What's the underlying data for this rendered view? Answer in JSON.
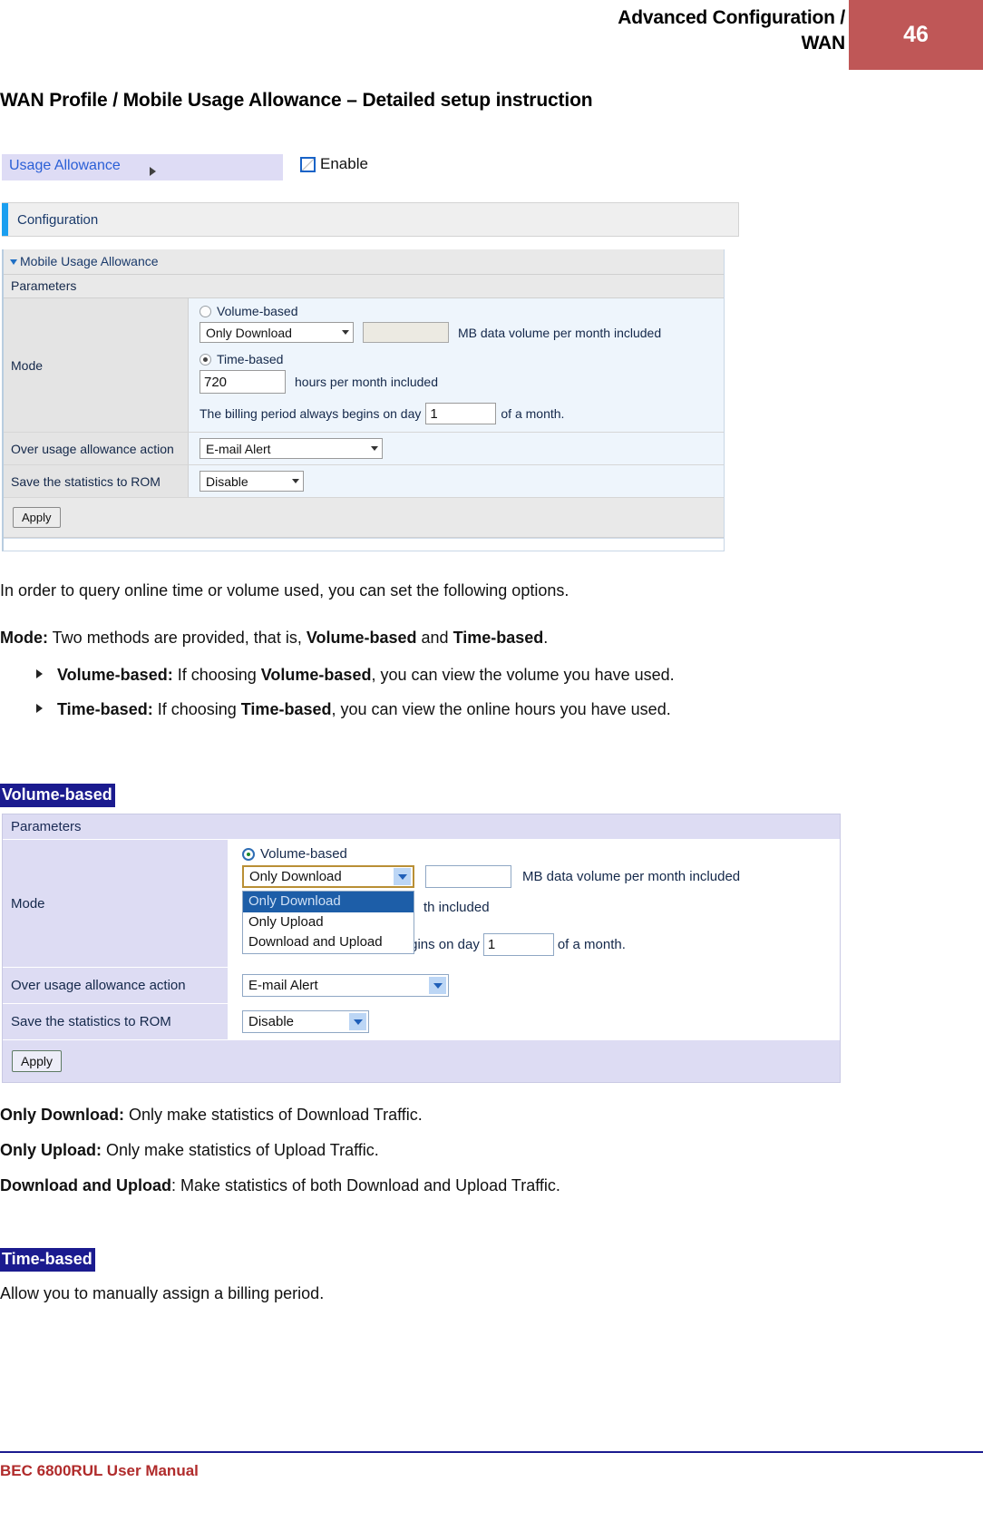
{
  "header": {
    "title_line1": "Advanced Configuration /",
    "title_line2": "WAN",
    "page_number": "46",
    "accent_color": "#bf5757"
  },
  "section_title": "WAN Profile / Mobile Usage Allowance – Detailed setup instruction",
  "screenshot1": {
    "tab_label": "Usage Allowance",
    "enable_label": "Enable",
    "configuration_label": "Configuration",
    "group_label": "Mobile Usage Allowance",
    "parameters_label": "Parameters",
    "mode_label": "Mode",
    "volume_based_label": "Volume-based",
    "volume_select_value": "Only Download",
    "volume_input_value": "",
    "volume_unit_text": "MB data volume per month included",
    "time_based_label": "Time-based",
    "time_input_value": "720",
    "time_unit_text": "hours per month included",
    "billing_prefix": "The billing period always begins on day",
    "billing_day_value": "1",
    "billing_suffix": "of a month.",
    "over_usage_label": "Over usage allowance action",
    "over_usage_value": "E-mail Alert",
    "save_rom_label": "Save the statistics to ROM",
    "save_rom_value": "Disable",
    "apply_label": "Apply"
  },
  "body": {
    "intro": "In order to query online time or volume used, you can set the following options.",
    "mode_bold": "Mode:",
    "mode_rest_1": " Two methods are provided, that is, ",
    "mode_b1": "Volume-based",
    "mode_rest_2": " and ",
    "mode_b2": "Time-based",
    "mode_rest_3": ".",
    "bullet1_bold": "Volume-based:",
    "bullet1_t1": " If choosing ",
    "bullet1_b": "Volume-based",
    "bullet1_t2": ", you can view the volume you have used.",
    "bullet2_bold": "Time-based:",
    "bullet2_t1": " If choosing ",
    "bullet2_b": "Time-based",
    "bullet2_t2": ", you can view the online hours you have used."
  },
  "volume_heading": "Volume-based",
  "screenshot2": {
    "parameters_label": "Parameters",
    "mode_label": "Mode",
    "volume_based_label": "Volume-based",
    "select_value": "Only Download",
    "options": [
      "Only Download",
      "Only Upload",
      "Download and Upload"
    ],
    "selected_option_index": 0,
    "volume_input_value": "",
    "volume_unit_text": "MB data volume per month included",
    "occluded_unit_text": "th included",
    "billing_prefix": "The billing period always begins on day",
    "billing_day_value": "1",
    "billing_suffix": "of a month.",
    "over_usage_label": "Over usage allowance action",
    "over_usage_value": "E-mail Alert",
    "save_rom_label": "Save the statistics to ROM",
    "save_rom_value": "Disable",
    "apply_label": "Apply"
  },
  "definitions": {
    "d1_bold": "Only Download:",
    "d1_text": " Only make statistics of Download Traffic.",
    "d2_bold": "Only Upload:",
    "d2_text": " Only make statistics of Upload Traffic.",
    "d3_bold": "Download and Upload",
    "d3_text": ": Make statistics of both Download and Upload Traffic."
  },
  "time_heading": "Time-based",
  "time_text": "Allow you to manually assign a billing period.",
  "footer": {
    "text": "BEC 6800RUL User Manual",
    "color": "#b02b2b"
  }
}
